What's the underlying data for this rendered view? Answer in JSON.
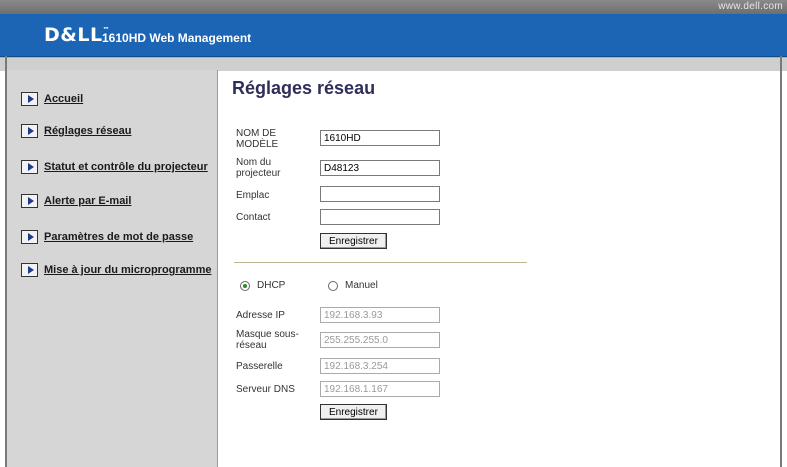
{
  "topbar": {
    "url": "www.dell.com"
  },
  "header": {
    "logo": "D&LL",
    "logo_tm": "™",
    "title": "1610HD Web Management"
  },
  "sidebar": {
    "items": [
      {
        "label": "Accueil"
      },
      {
        "label": "Réglages réseau"
      },
      {
        "label": "Statut et contrôle du projecteur"
      },
      {
        "label": "Alerte par E-mail"
      },
      {
        "label": "Paramètres de mot de passe"
      },
      {
        "label": "Mise à jour du microprogramme"
      }
    ]
  },
  "main": {
    "title": "Réglages réseau",
    "form1": {
      "model_label_1": "NOM DE",
      "model_label_2": "MODÈLE",
      "model_value": "1610HD",
      "name_label_1": "Nom du",
      "name_label_2": "projecteur",
      "name_value": "D48123",
      "location_label": "Emplac",
      "location_value": "",
      "contact_label": "Contact",
      "contact_value": "",
      "save_label": "Enregistrer"
    },
    "form2": {
      "dhcp_label": "DHCP",
      "manual_label": "Manuel",
      "selected": "DHCP",
      "ip_label": "Adresse IP",
      "ip_value": "192.168.3.93",
      "mask_label_1": "Masque sous-",
      "mask_label_2": "réseau",
      "mask_value": "255.255.255.0",
      "gateway_label": "Passerelle",
      "gateway_value": "192.168.3.254",
      "dns_label": "Serveur DNS",
      "dns_value": "192.168.1.167",
      "save_label": "Enregistrer"
    }
  },
  "colors": {
    "header": "#1c64b4",
    "sidebar": "#d6d6d6",
    "title": "#2e2e5a",
    "radio_selected": "#2a8a2a"
  }
}
